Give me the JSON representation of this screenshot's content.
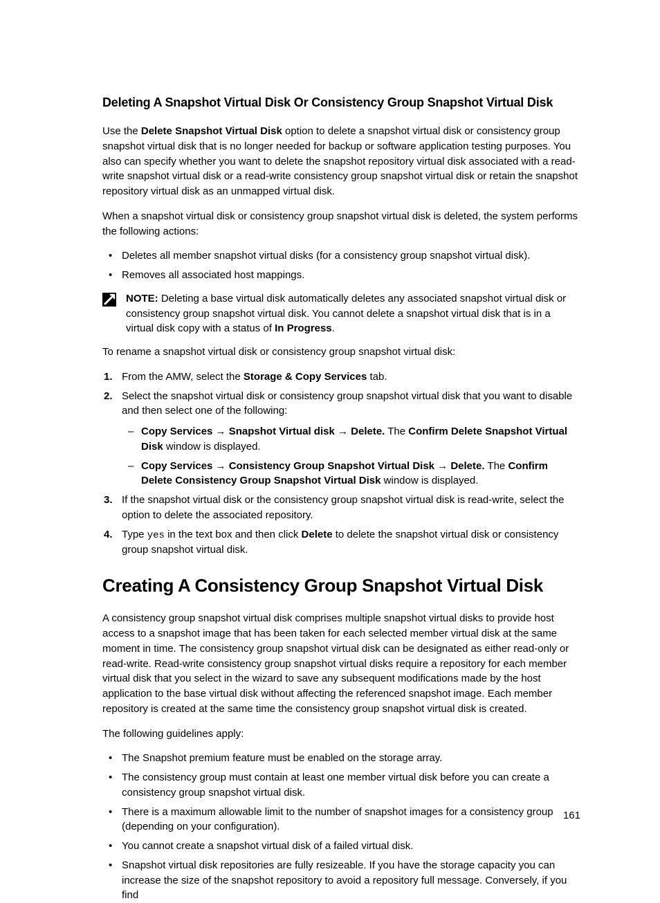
{
  "section1": {
    "heading": "Deleting A Snapshot Virtual Disk Or Consistency Group Snapshot Virtual Disk",
    "p1_a": "Use the ",
    "p1_bold": "Delete Snapshot Virtual Disk",
    "p1_b": " option to delete a snapshot virtual disk or consistency group snapshot virtual disk that is no longer needed for backup or software application testing purposes. You also can specify whether you want to delete the snapshot repository virtual disk associated with a read-write snapshot virtual disk or a read-write consistency group snapshot virtual disk or retain the snapshot repository virtual disk as an unmapped virtual disk.",
    "p2": "When a snapshot virtual disk or consistency group snapshot virtual disk is deleted, the system performs the following actions:",
    "bullets": [
      "Deletes all member snapshot virtual disks (for a consistency group snapshot virtual disk).",
      "Removes all associated host mappings."
    ],
    "note_label": "NOTE:",
    "note_a": " Deleting a base virtual disk automatically deletes any associated snapshot virtual disk or consistency group snapshot virtual disk. You cannot delete a snapshot virtual disk that is in a virtual disk copy with a status of ",
    "note_bold": "In Progress",
    "note_b": ".",
    "p3": "To rename a snapshot virtual disk or consistency group snapshot virtual disk:",
    "step1_a": "From the AMW, select the ",
    "step1_bold": "Storage & Copy Services",
    "step1_b": " tab.",
    "step2": "Select the snapshot virtual disk or consistency group snapshot virtual disk that you want to disable and then select one of the following:",
    "step2_sub1_bold": "Copy Services → Snapshot Virtual disk → Delete.",
    "step2_sub1_a": " The ",
    "step2_sub1_bold2": "Confirm Delete Snapshot Virtual Disk",
    "step2_sub1_b": " window is displayed.",
    "step2_sub2_bold": "Copy Services → Consistency Group Snapshot Virtual Disk → Delete.",
    "step2_sub2_a": " The ",
    "step2_sub2_bold2": "Confirm Delete Consistency Group Snapshot Virtual Disk",
    "step2_sub2_b": " window is displayed.",
    "step3": "If the snapshot virtual disk or the consistency group snapshot virtual disk is read-write, select the option to delete the associated repository.",
    "step4_a": "Type ",
    "step4_code": "yes",
    "step4_b": " in the text box and then click ",
    "step4_bold": "Delete",
    "step4_c": " to delete the snapshot virtual disk or consistency group snapshot virtual disk."
  },
  "section2": {
    "heading": "Creating A Consistency Group Snapshot Virtual Disk",
    "p1": "A consistency group snapshot virtual disk comprises multiple snapshot virtual disks to provide host access to a snapshot image that has been taken for each selected member virtual disk at the same moment in time. The consistency group snapshot virtual disk can be designated as either read-only or read-write. Read-write consistency group snapshot virtual disks require a repository for each member virtual disk that you select in the wizard to save any subsequent modifications made by the host application to the base virtual disk without affecting the referenced snapshot image. Each member repository is created at the same time the consistency group snapshot virtual disk is created.",
    "p2": "The following guidelines apply:",
    "bullets": [
      "The Snapshot premium feature must be enabled on the storage array.",
      "The consistency group must contain at least one member virtual disk before you can create a consistency group snapshot virtual disk.",
      "There is a maximum allowable limit to the number of snapshot images for a consistency group (depending on your configuration).",
      "You cannot create a snapshot virtual disk of a failed virtual disk.",
      "Snapshot virtual disk repositories are fully resizeable. If you have the storage capacity you can increase the size of the snapshot repository to avoid a repository full message. Conversely, if you find"
    ]
  },
  "page_number": "161"
}
